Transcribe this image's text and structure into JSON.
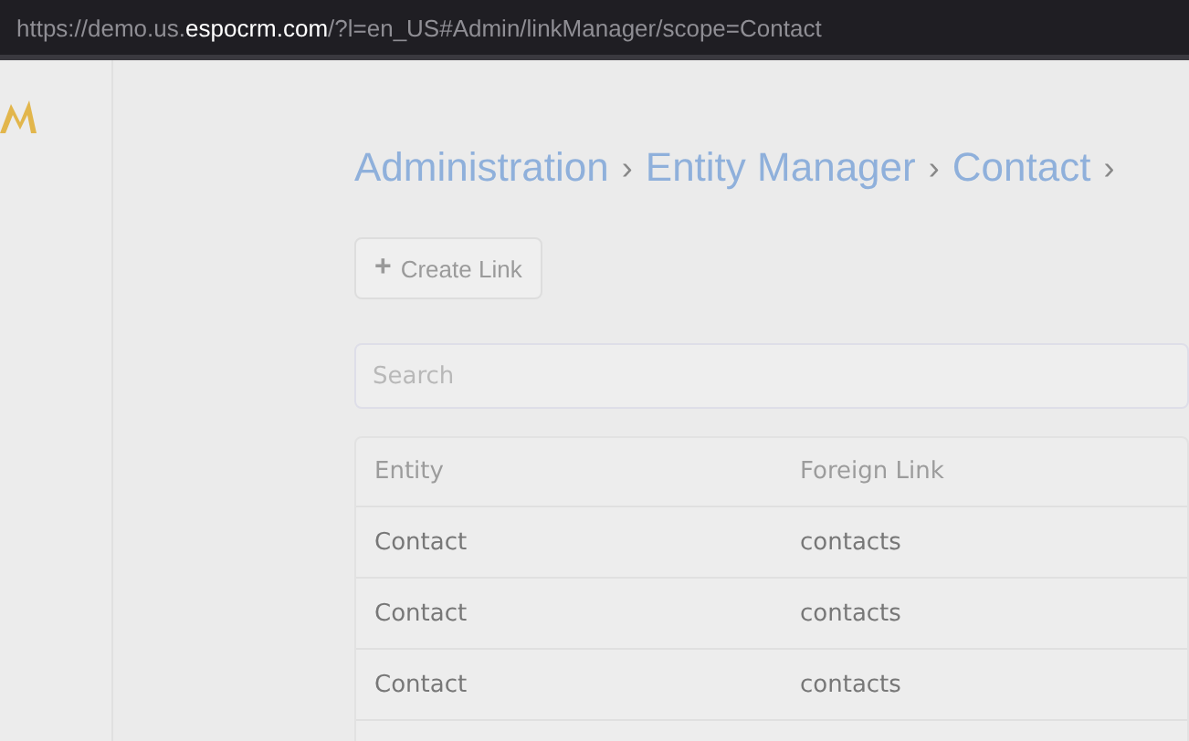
{
  "address_bar": {
    "url_parts": [
      {
        "kind": "plain",
        "text": "https://demo.us."
      },
      {
        "kind": "host",
        "text": "espocrm.com"
      },
      {
        "kind": "plain",
        "text": "/?l=en_US#Admin/linkManager/scope=Contact"
      }
    ]
  },
  "breadcrumb": [
    {
      "kind": "link",
      "text": "Administration"
    },
    {
      "kind": "separator",
      "text": "›"
    },
    {
      "kind": "link",
      "text": "Entity Manager"
    },
    {
      "kind": "separator",
      "text": "›"
    },
    {
      "kind": "link",
      "text": "Contact"
    },
    {
      "kind": "separator",
      "text": "›"
    }
  ],
  "create_button": {
    "icon": "+",
    "label": "Create Link"
  },
  "search": {
    "placeholder": "Search"
  },
  "table": {
    "columns": [
      "Entity",
      "Foreign Link"
    ],
    "rows": [
      [
        "Contact",
        "contacts"
      ],
      [
        "Contact",
        "contacts"
      ],
      [
        "Contact",
        "contacts"
      ]
    ]
  }
}
